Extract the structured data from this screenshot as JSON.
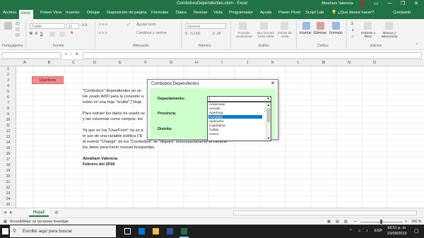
{
  "window": {
    "title": "ComboboxDependientes.xlsm - Excel",
    "user": "Abraham Valencia",
    "share": "Compartir"
  },
  "tabs": [
    "Archivo",
    "Inicio",
    "Power View",
    "Insertar",
    "Dibujar",
    "Disposición de página",
    "Fórmulas",
    "Datos",
    "Revisar",
    "Vista",
    "Programador",
    "Ayuda",
    "Power Pivot",
    "Script Lab"
  ],
  "tell_me": "¿Qué desea hacer?",
  "ribbon": {
    "font_name": "Calibri",
    "font_size": "11",
    "wrap_text": "Ajustar texto",
    "merge": "Combinar y centrar",
    "number_format": "General",
    "cond_format": "Formato condicional",
    "table_format": "Dar formato como tabla",
    "cell_styles": "Estilos de celda",
    "insert": "Insertar",
    "delete": "Eliminar",
    "format": "Formato",
    "sort_filter": "Ordenar y filtrar",
    "find_select": "Buscar y seleccionar",
    "groups": [
      "Portapapeles",
      "Fuente",
      "Alineación",
      "Número",
      "Estilos",
      "Celdas",
      "Edición"
    ]
  },
  "formula_bar": {
    "cell_ref": "",
    "fx": "fx"
  },
  "columns": [
    "A",
    "B",
    "C",
    "D",
    "E",
    "F",
    "G",
    "H",
    "I",
    "J",
    "K",
    "L",
    "M",
    "N",
    "O"
  ],
  "rows": [
    "1",
    "2",
    "3",
    "4",
    "5",
    "6",
    "7",
    "8",
    "9",
    "10",
    "11",
    "12",
    "13",
    "14",
    "15",
    "16",
    "17",
    "18",
    "19",
    "20",
    "21",
    "22",
    "23",
    "24",
    "25"
  ],
  "userform_button": "Userform",
  "sheet_text": {
    "r5": "\"Combobox\" dependientes en un",
    "r6": "He usado ADO para la conexión a",
    "r7": "están en una hoja \"oculta\" (\"Hoja",
    "r9": "Para extraer los datos he usado se",
    "r10": "y las columnas como campos, los",
    "r12": "Ya que en los \"UserForm\" no se p",
    "r13": "el uso de una variable pública (\"E",
    "r14": "el evento \"Change\" de los \"Combobox\" se \"dispare\" innecesariamente al cambiar",
    "r15": "los datos para hacer nuevas busquedas.",
    "r17": "Abraham Valencia",
    "r18": "Febrero del 2018"
  },
  "dialog": {
    "title": "Combobox Dependientes",
    "close": "✕",
    "labels": {
      "dep": "Departamento:",
      "prov": "Provincia:",
      "dist": "Distrito:"
    },
    "combo_value": "|",
    "items": [
      "Amazonas",
      "Ancash",
      "Apurímac",
      "Arequipa",
      "Ayacucho",
      "Cajamarca",
      "Callao",
      "Cusco"
    ],
    "selected": "Arequipa"
  },
  "sheet_tab": "Hoja2",
  "status": {
    "accessibility": "Accesibilidad: es necesario investigar",
    "zoom": "100 %"
  },
  "taskbar": {
    "search": "Escribir aquí para buscar",
    "time": "18:51 p. m.",
    "date": "23/09/2019",
    "lang": "ESP"
  }
}
